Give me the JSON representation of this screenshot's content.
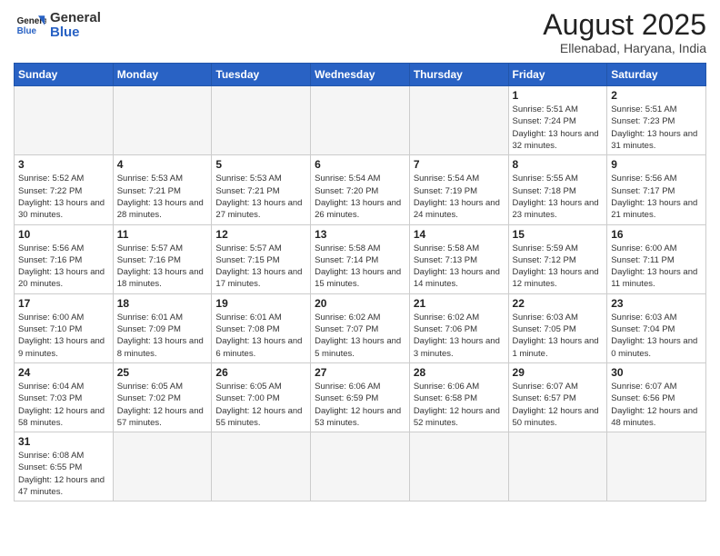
{
  "logo": {
    "line1": "General",
    "line2": "Blue"
  },
  "calendar": {
    "title": "August 2025",
    "subtitle": "Ellenabad, Haryana, India",
    "weekdays": [
      "Sunday",
      "Monday",
      "Tuesday",
      "Wednesday",
      "Thursday",
      "Friday",
      "Saturday"
    ],
    "weeks": [
      [
        {
          "day": "",
          "info": ""
        },
        {
          "day": "",
          "info": ""
        },
        {
          "day": "",
          "info": ""
        },
        {
          "day": "",
          "info": ""
        },
        {
          "day": "",
          "info": ""
        },
        {
          "day": "1",
          "info": "Sunrise: 5:51 AM\nSunset: 7:24 PM\nDaylight: 13 hours and 32 minutes."
        },
        {
          "day": "2",
          "info": "Sunrise: 5:51 AM\nSunset: 7:23 PM\nDaylight: 13 hours and 31 minutes."
        }
      ],
      [
        {
          "day": "3",
          "info": "Sunrise: 5:52 AM\nSunset: 7:22 PM\nDaylight: 13 hours and 30 minutes."
        },
        {
          "day": "4",
          "info": "Sunrise: 5:53 AM\nSunset: 7:21 PM\nDaylight: 13 hours and 28 minutes."
        },
        {
          "day": "5",
          "info": "Sunrise: 5:53 AM\nSunset: 7:21 PM\nDaylight: 13 hours and 27 minutes."
        },
        {
          "day": "6",
          "info": "Sunrise: 5:54 AM\nSunset: 7:20 PM\nDaylight: 13 hours and 26 minutes."
        },
        {
          "day": "7",
          "info": "Sunrise: 5:54 AM\nSunset: 7:19 PM\nDaylight: 13 hours and 24 minutes."
        },
        {
          "day": "8",
          "info": "Sunrise: 5:55 AM\nSunset: 7:18 PM\nDaylight: 13 hours and 23 minutes."
        },
        {
          "day": "9",
          "info": "Sunrise: 5:56 AM\nSunset: 7:17 PM\nDaylight: 13 hours and 21 minutes."
        }
      ],
      [
        {
          "day": "10",
          "info": "Sunrise: 5:56 AM\nSunset: 7:16 PM\nDaylight: 13 hours and 20 minutes."
        },
        {
          "day": "11",
          "info": "Sunrise: 5:57 AM\nSunset: 7:16 PM\nDaylight: 13 hours and 18 minutes."
        },
        {
          "day": "12",
          "info": "Sunrise: 5:57 AM\nSunset: 7:15 PM\nDaylight: 13 hours and 17 minutes."
        },
        {
          "day": "13",
          "info": "Sunrise: 5:58 AM\nSunset: 7:14 PM\nDaylight: 13 hours and 15 minutes."
        },
        {
          "day": "14",
          "info": "Sunrise: 5:58 AM\nSunset: 7:13 PM\nDaylight: 13 hours and 14 minutes."
        },
        {
          "day": "15",
          "info": "Sunrise: 5:59 AM\nSunset: 7:12 PM\nDaylight: 13 hours and 12 minutes."
        },
        {
          "day": "16",
          "info": "Sunrise: 6:00 AM\nSunset: 7:11 PM\nDaylight: 13 hours and 11 minutes."
        }
      ],
      [
        {
          "day": "17",
          "info": "Sunrise: 6:00 AM\nSunset: 7:10 PM\nDaylight: 13 hours and 9 minutes."
        },
        {
          "day": "18",
          "info": "Sunrise: 6:01 AM\nSunset: 7:09 PM\nDaylight: 13 hours and 8 minutes."
        },
        {
          "day": "19",
          "info": "Sunrise: 6:01 AM\nSunset: 7:08 PM\nDaylight: 13 hours and 6 minutes."
        },
        {
          "day": "20",
          "info": "Sunrise: 6:02 AM\nSunset: 7:07 PM\nDaylight: 13 hours and 5 minutes."
        },
        {
          "day": "21",
          "info": "Sunrise: 6:02 AM\nSunset: 7:06 PM\nDaylight: 13 hours and 3 minutes."
        },
        {
          "day": "22",
          "info": "Sunrise: 6:03 AM\nSunset: 7:05 PM\nDaylight: 13 hours and 1 minute."
        },
        {
          "day": "23",
          "info": "Sunrise: 6:03 AM\nSunset: 7:04 PM\nDaylight: 13 hours and 0 minutes."
        }
      ],
      [
        {
          "day": "24",
          "info": "Sunrise: 6:04 AM\nSunset: 7:03 PM\nDaylight: 12 hours and 58 minutes."
        },
        {
          "day": "25",
          "info": "Sunrise: 6:05 AM\nSunset: 7:02 PM\nDaylight: 12 hours and 57 minutes."
        },
        {
          "day": "26",
          "info": "Sunrise: 6:05 AM\nSunset: 7:00 PM\nDaylight: 12 hours and 55 minutes."
        },
        {
          "day": "27",
          "info": "Sunrise: 6:06 AM\nSunset: 6:59 PM\nDaylight: 12 hours and 53 minutes."
        },
        {
          "day": "28",
          "info": "Sunrise: 6:06 AM\nSunset: 6:58 PM\nDaylight: 12 hours and 52 minutes."
        },
        {
          "day": "29",
          "info": "Sunrise: 6:07 AM\nSunset: 6:57 PM\nDaylight: 12 hours and 50 minutes."
        },
        {
          "day": "30",
          "info": "Sunrise: 6:07 AM\nSunset: 6:56 PM\nDaylight: 12 hours and 48 minutes."
        }
      ],
      [
        {
          "day": "31",
          "info": "Sunrise: 6:08 AM\nSunset: 6:55 PM\nDaylight: 12 hours and 47 minutes."
        },
        {
          "day": "",
          "info": ""
        },
        {
          "day": "",
          "info": ""
        },
        {
          "day": "",
          "info": ""
        },
        {
          "day": "",
          "info": ""
        },
        {
          "day": "",
          "info": ""
        },
        {
          "day": "",
          "info": ""
        }
      ]
    ]
  }
}
